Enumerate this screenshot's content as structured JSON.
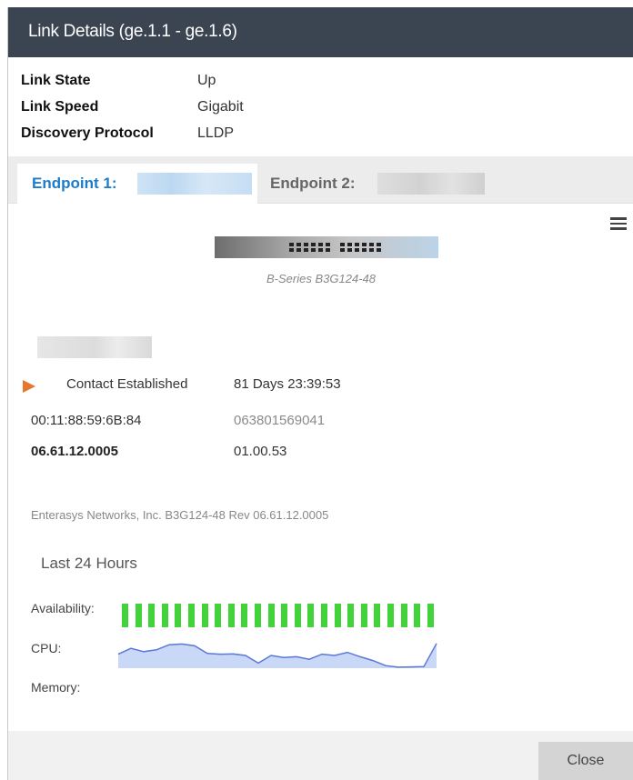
{
  "dialog": {
    "title": "Link Details (ge.1.1 - ge.1.6)"
  },
  "properties": [
    {
      "key": "Link State",
      "value": "Up"
    },
    {
      "key": "Link Speed",
      "value": "Gigabit"
    },
    {
      "key": "Discovery Protocol",
      "value": "LLDP"
    }
  ],
  "tabs": [
    {
      "label": "Endpoint 1:",
      "active": true
    },
    {
      "label": "Endpoint 2:",
      "active": false
    }
  ],
  "device": {
    "model_caption": "B-Series B3G124-48",
    "status_label": "Contact Established",
    "uptime": "81 Days 23:39:53",
    "mac": "00:11:88:59:6B:84",
    "serial": "063801569041",
    "firmware": "06.61.12.0005",
    "boot_prom": "01.00.53",
    "description": "Enterasys Networks, Inc. B3G124-48 Rev 06.61.12.0005"
  },
  "stats": {
    "title": "Last 24 Hours",
    "availability_label": "Availability:",
    "cpu_label": "CPU:",
    "memory_label": "Memory:",
    "availability_bars": 24,
    "cpu_series": [
      0.55,
      0.78,
      0.65,
      0.72,
      0.92,
      0.95,
      0.88,
      0.58,
      0.55,
      0.56,
      0.5,
      0.2,
      0.5,
      0.42,
      0.45,
      0.35,
      0.55,
      0.5,
      0.62,
      0.45,
      0.3,
      0.1,
      0.04,
      0.05,
      0.06,
      0.97
    ]
  },
  "colors": {
    "titlebar": "#3b4451",
    "active_tab": "#1d7cc9",
    "status_arrow": "#e8772e",
    "availability": "#42d33a",
    "cpu_fill": "#c9d8f7",
    "cpu_line": "#5a78d6"
  },
  "icons": {
    "menu": "hamburger-menu-icon",
    "status": "play-triangle-icon"
  },
  "footer": {
    "close_label": "Close"
  }
}
